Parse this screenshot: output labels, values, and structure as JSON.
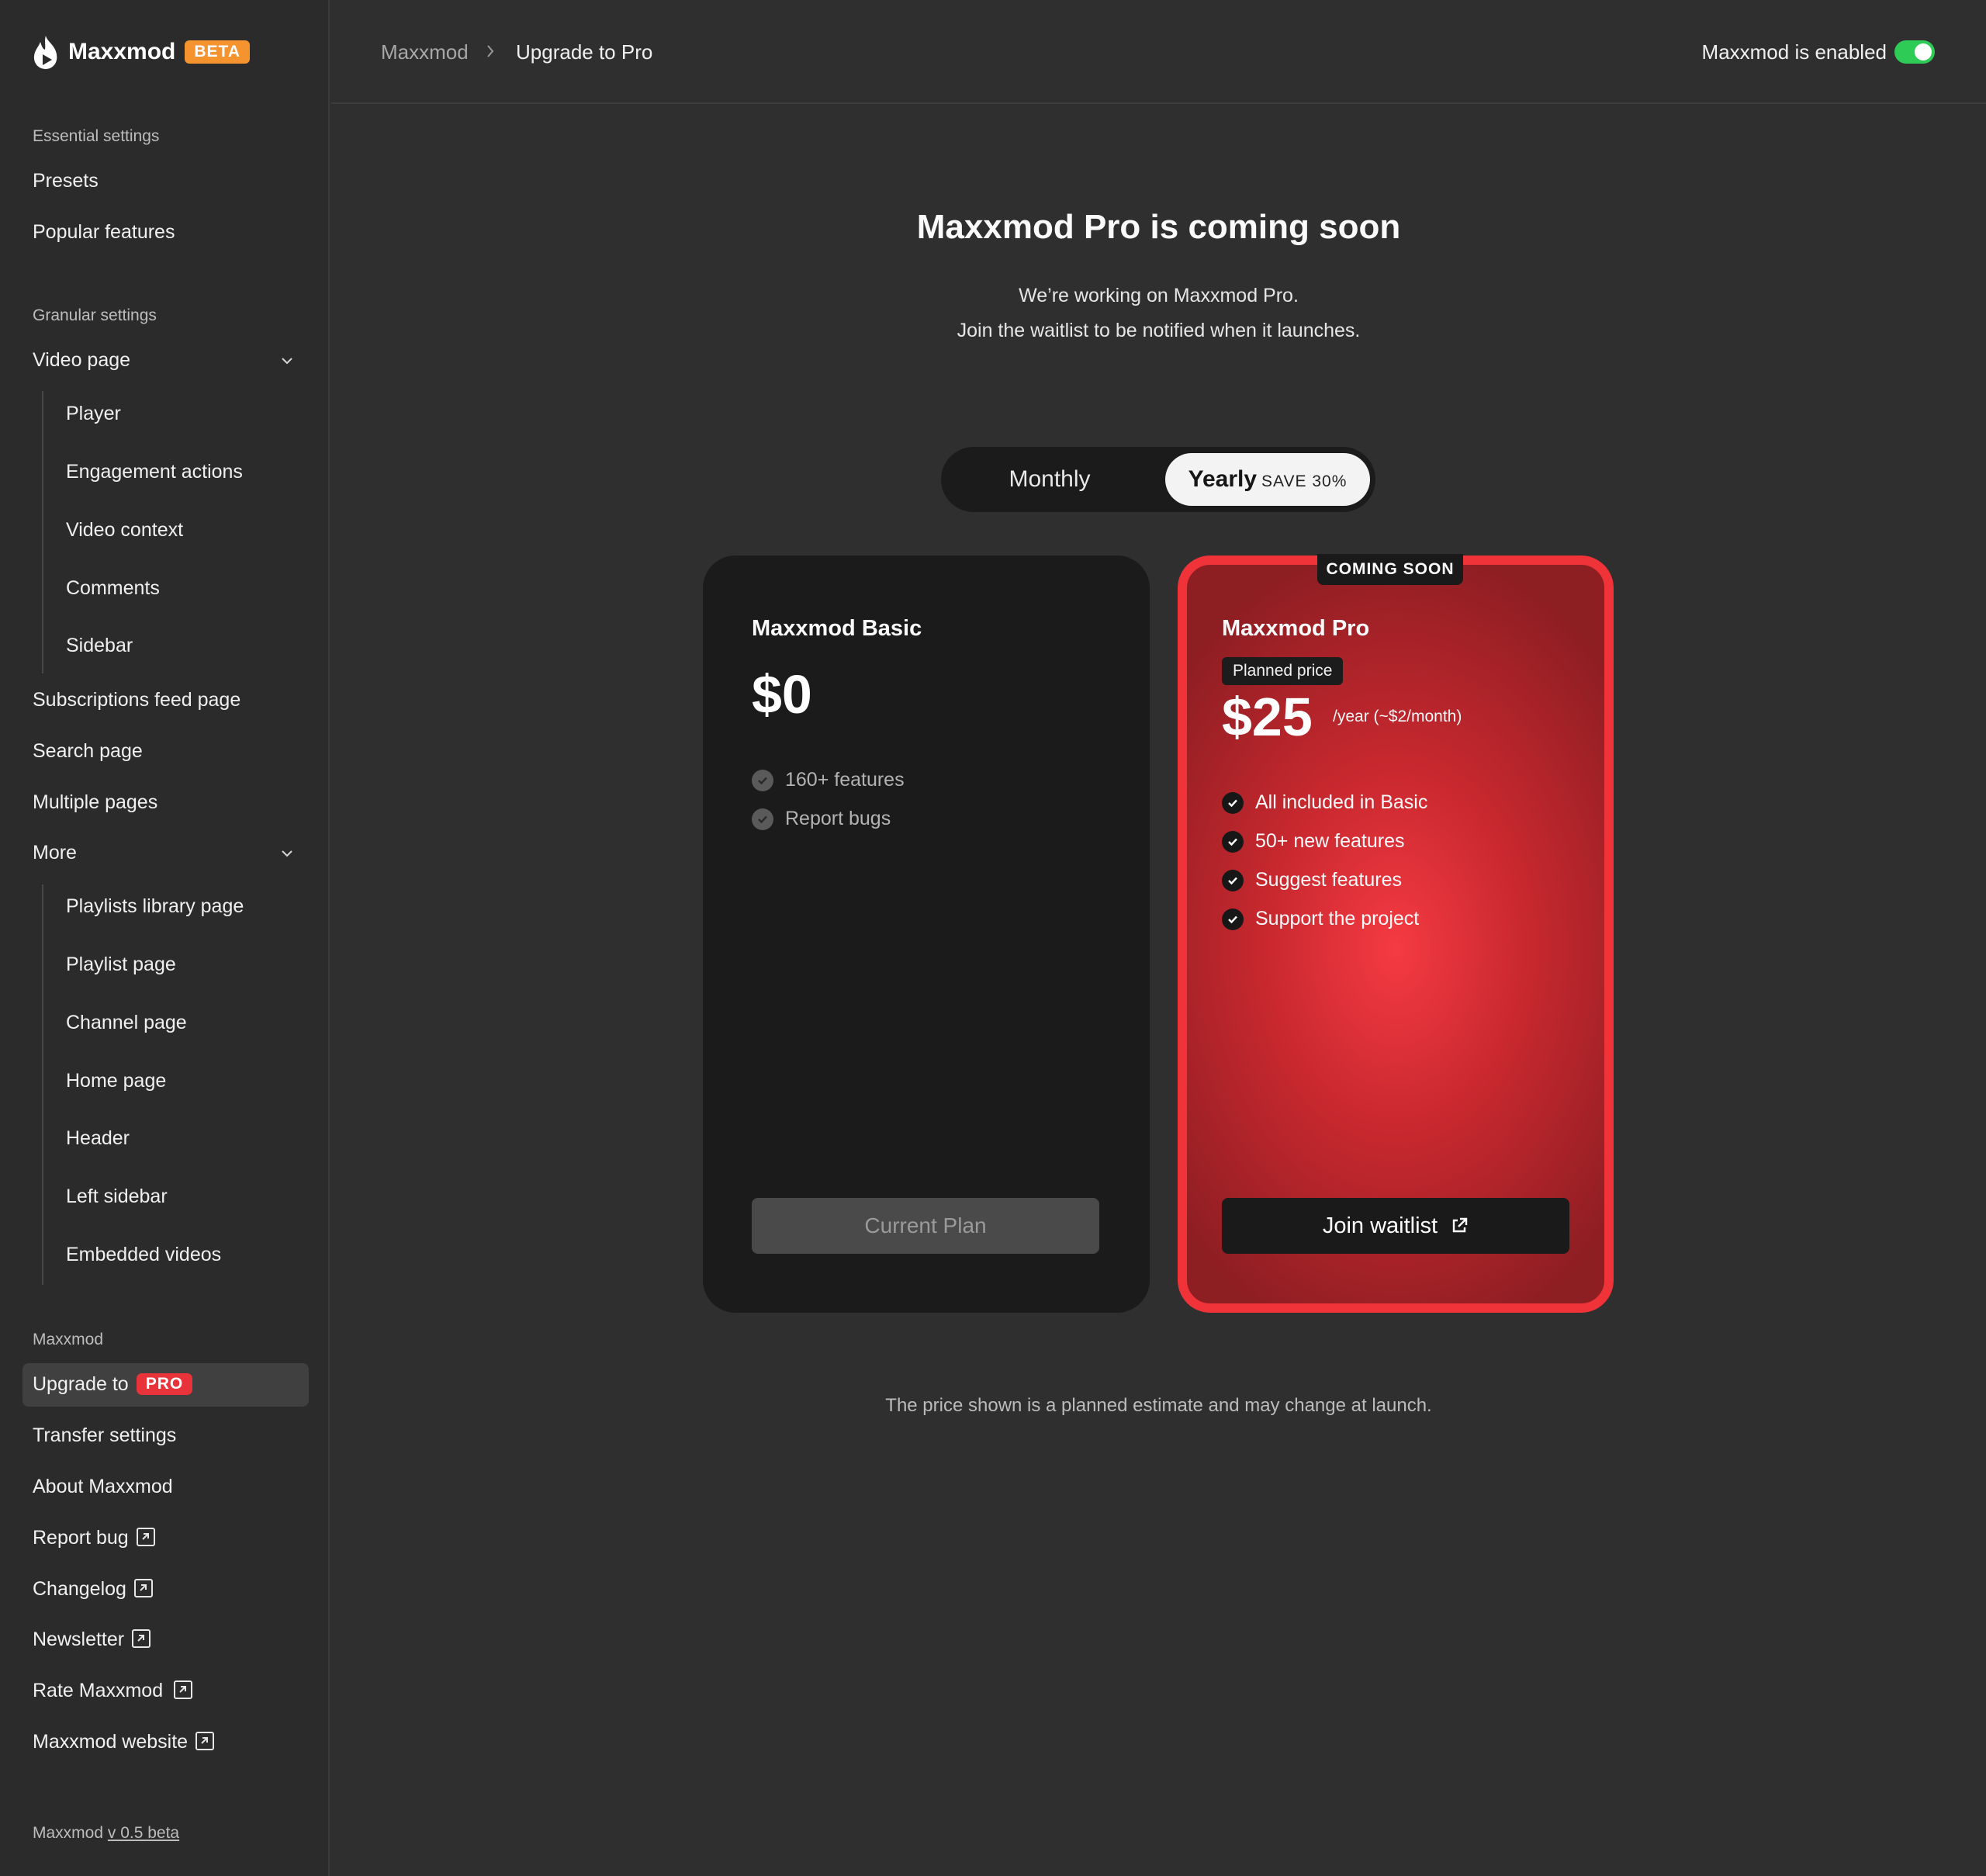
{
  "app": {
    "name": "Maxxmod",
    "badge": "BETA"
  },
  "sidebar": {
    "essential_label": "Essential settings",
    "essential_items": [
      "Presets",
      "Popular features"
    ],
    "granular_label": "Granular settings",
    "video_page": "Video page",
    "video_sub": [
      "Player",
      "Engagement actions",
      "Video context",
      "Comments",
      "Sidebar"
    ],
    "granular_items": [
      "Subscriptions feed page",
      "Search page",
      "Multiple pages"
    ],
    "more": "More",
    "more_sub": [
      "Playlists library page",
      "Playlist page",
      "Channel page",
      "Home page",
      "Header",
      "Left sidebar",
      "Embedded videos"
    ],
    "maxxmod_label": "Maxxmod",
    "upgrade_label": "Upgrade to",
    "upgrade_badge": "PRO",
    "transfer": "Transfer settings",
    "about": "About Maxxmod",
    "links": [
      "Report bug",
      "Changelog",
      "Newsletter",
      "Rate Maxxmod",
      "Maxxmod website"
    ],
    "version_prefix": "Maxxmod",
    "version_link": "v 0.5 beta"
  },
  "topbar": {
    "breadcrumb_root": "Maxxmod",
    "breadcrumb_current": "Upgrade to Pro",
    "enabled_label": "Maxxmod is enabled",
    "enabled": true
  },
  "main": {
    "title": "Maxxmod Pro is coming soon",
    "subtitle_line1": "We’re working on Maxxmod Pro.",
    "subtitle_line2": "Join the waitlist to be notified when it launches.",
    "billing": {
      "monthly": "Monthly",
      "yearly": "Yearly",
      "yearly_badge": "SAVE 30%",
      "selected": "Yearly"
    },
    "basic": {
      "name": "Maxxmod Basic",
      "price": "$0",
      "features": [
        "160+ features",
        "Report bugs"
      ],
      "button": "Current Plan"
    },
    "pro": {
      "ribbon": "COMING SOON",
      "name": "Maxxmod Pro",
      "tag": "Planned price",
      "price": "$25",
      "price_unit": "/year (~$2/month)",
      "features": [
        "All included in Basic",
        "50+ new features",
        "Suggest features",
        "Support the project"
      ],
      "button": "Join waitlist"
    },
    "footnote": "The price shown is a planned estimate and may change at launch."
  },
  "colors": {
    "accent_red": "#ef3339",
    "beta_orange": "#f5932e",
    "toggle_green": "#2ecc57"
  }
}
